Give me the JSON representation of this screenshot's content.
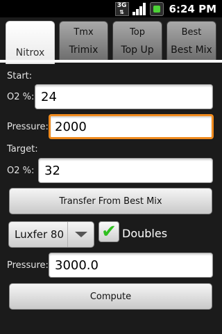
{
  "status_bar": {
    "network_label": "3G",
    "time": "6:24 PM",
    "icons": [
      "3g-data-icon",
      "signal-strength-icon",
      "battery-charging-icon"
    ]
  },
  "tabs": [
    {
      "icon_text": "",
      "label": "Nitrox",
      "active": true
    },
    {
      "icon_text": "Tmx",
      "label": "Trimix",
      "active": false
    },
    {
      "icon_text": "Top",
      "label": "Top Up",
      "active": false
    },
    {
      "icon_text": "Best",
      "label": "Best Mix",
      "active": false
    }
  ],
  "start": {
    "section_label": "Start:",
    "o2_label": "O2 %:",
    "o2_value": "24",
    "pressure_label": "Pressure:",
    "pressure_value": "2000"
  },
  "target": {
    "section_label": "Target:",
    "o2_label": "O2 %:",
    "o2_value": "32"
  },
  "transfer_button": "Transfer From Best Mix",
  "cylinder": {
    "selected": "Luxfer 80",
    "doubles_label": "Doubles",
    "doubles_checked": true
  },
  "result": {
    "pressure_label": "Pressure:",
    "pressure_value": "3000.0"
  },
  "compute_button": "Compute",
  "colors": {
    "focus_border": "#f08b1e",
    "check_mark": "#2fbf1f",
    "background": "#1b1b1b"
  }
}
